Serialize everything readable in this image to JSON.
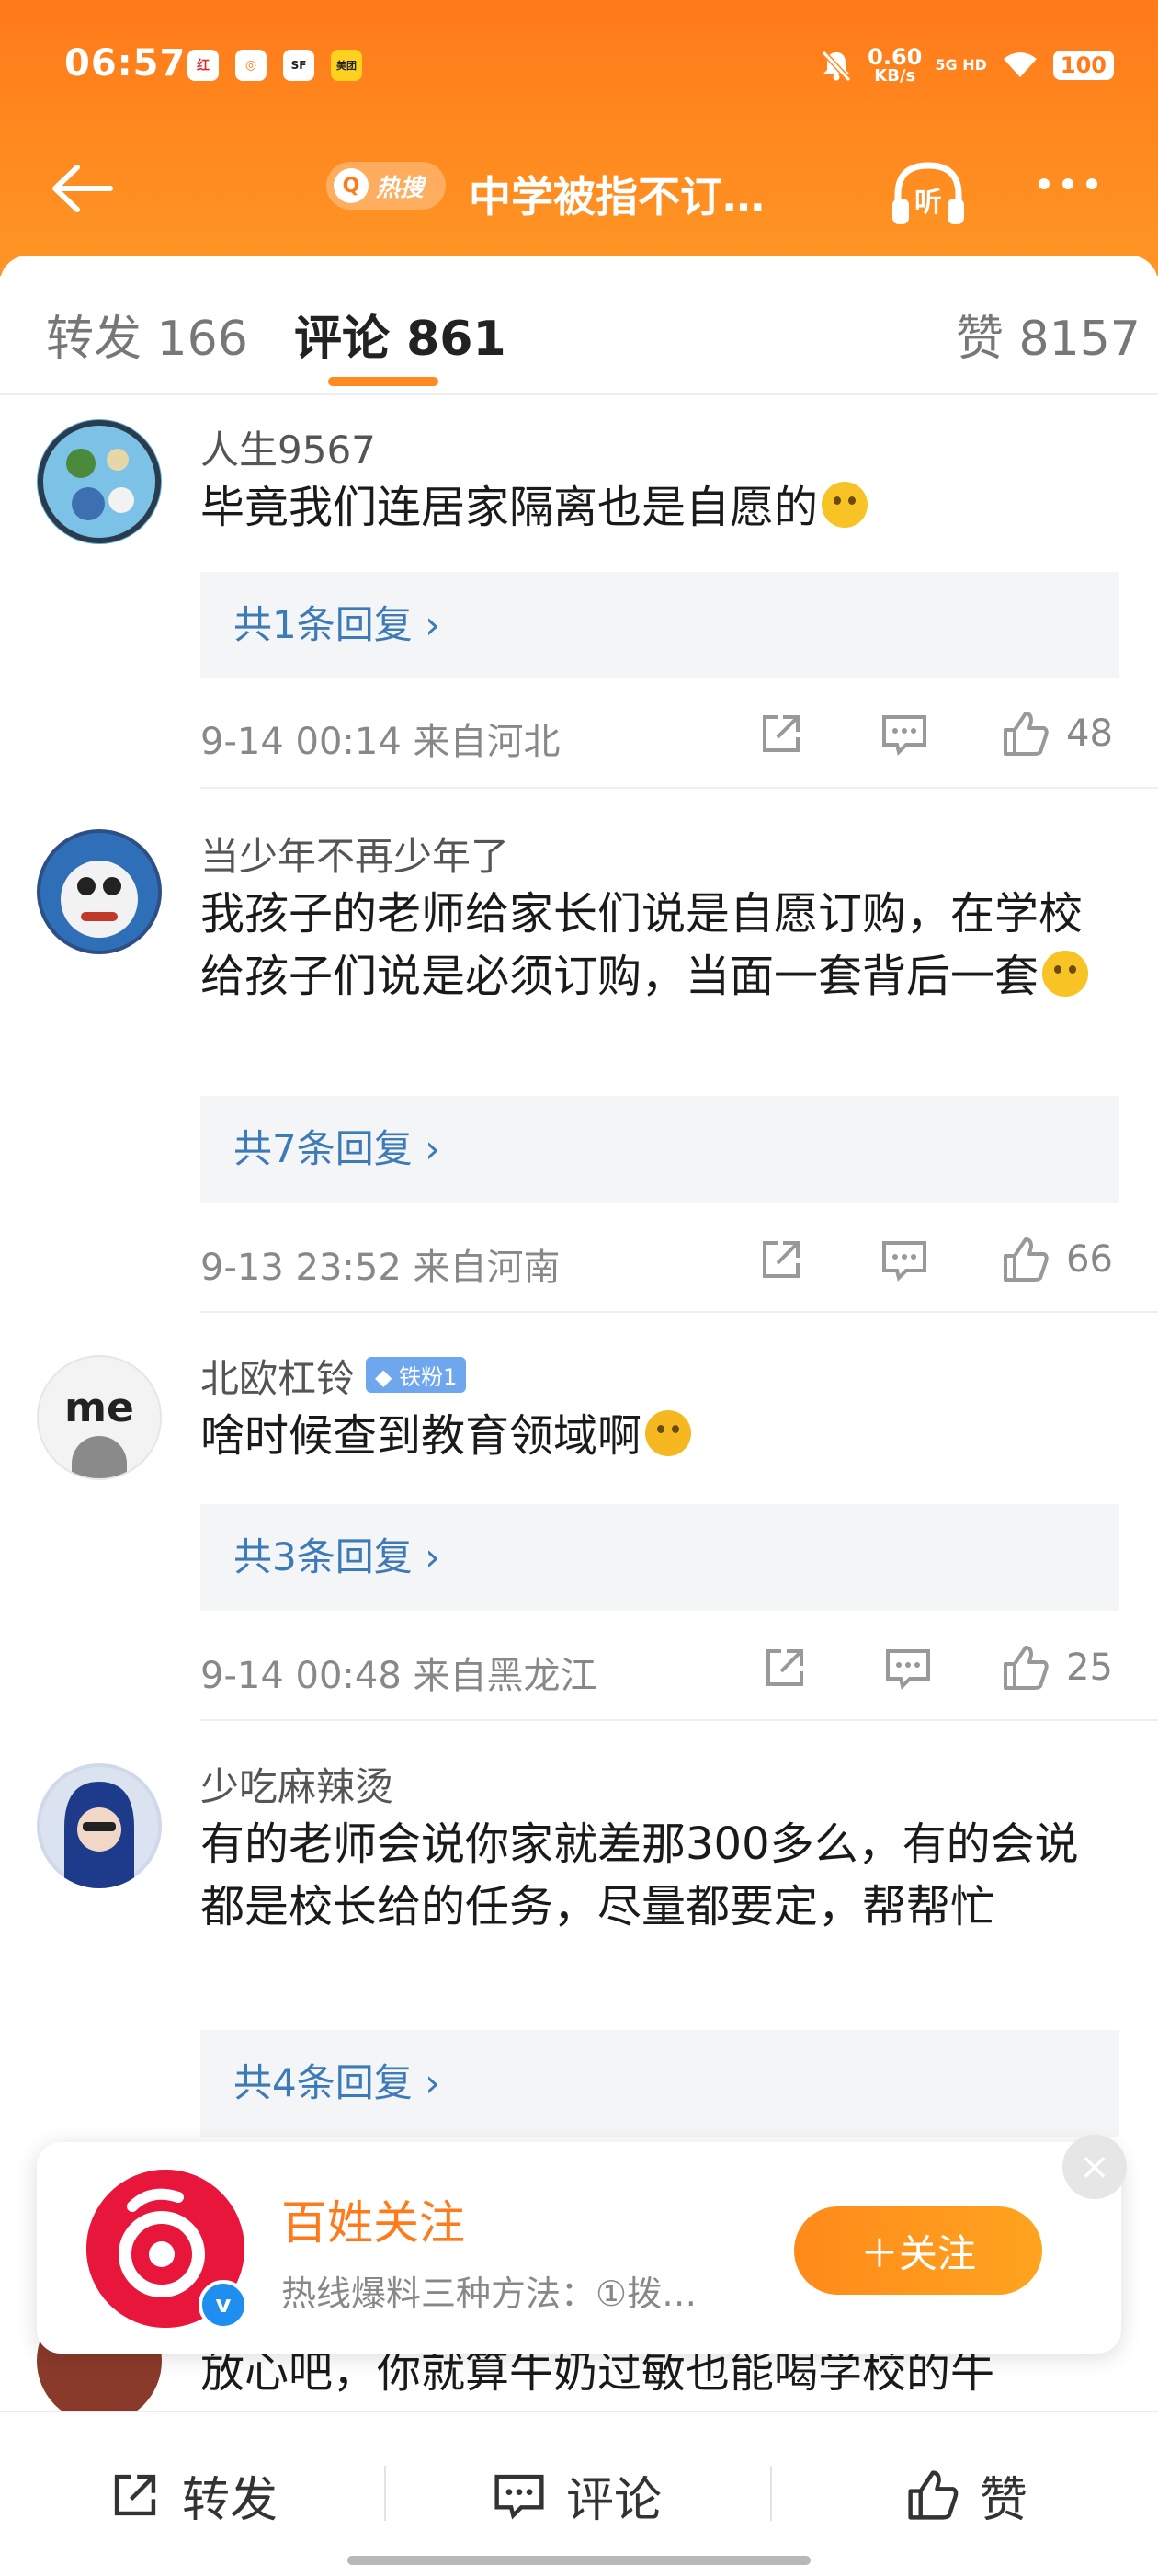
{
  "status_bar": {
    "time": "06:57",
    "app_icons": [
      "红",
      "◎",
      "SF",
      "美团"
    ],
    "network_speed": "0.60",
    "network_unit": "KB/s",
    "signal": "5G HD",
    "battery": "100"
  },
  "nav": {
    "hot_label": "热搜",
    "title": "中学被指不订…"
  },
  "tabs": [
    {
      "label": "转发",
      "count": "166"
    },
    {
      "label": "评论",
      "count": "861"
    },
    {
      "label": "赞",
      "count": "8157"
    }
  ],
  "comments": [
    {
      "author": "人生9567",
      "text": "毕竟我们连居家隔离也是自愿的",
      "replies": "共1条回复",
      "date": "9-14 00:14",
      "location": "来自河北",
      "likes": "48"
    },
    {
      "author": "当少年不再少年了",
      "text": "我孩子的老师给家长们说是自愿订购，在学校给孩子们说是必须订购，当面一套背后一套",
      "replies": "共7条回复",
      "date": "9-13 23:52",
      "location": "来自河南",
      "likes": "66"
    },
    {
      "author": "北欧杠铃",
      "badge": "铁粉1",
      "avatar_text": "me",
      "text": "啥时候查到教育领域啊",
      "replies": "共3条回复",
      "date": "9-14 00:48",
      "location": "来自黑龙江",
      "likes": "25"
    },
    {
      "author": "少吃麻辣烫",
      "text": "有的老师会说你家就差那300多么，有的会说都是校长给的任务，尽量都要定，帮帮忙",
      "replies": "共4条回复"
    },
    {
      "text": "放心吧，你就算牛奶过敏也能喝学校的牛"
    }
  ],
  "follow_card": {
    "name": "百姓关注",
    "desc": "热线爆料三种方法：①拨…",
    "button": "＋关注",
    "verified": "v"
  },
  "bottom_bar": {
    "repost": "转发",
    "comment": "评论",
    "like": "赞"
  }
}
